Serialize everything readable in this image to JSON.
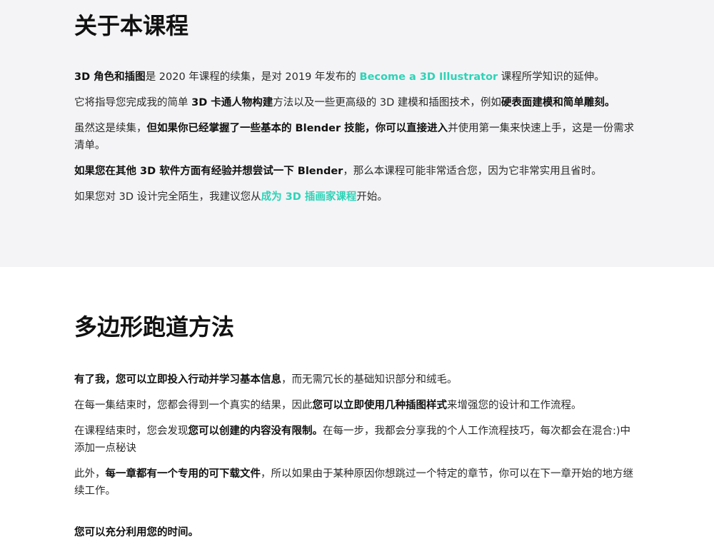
{
  "about": {
    "title": "关于本课程",
    "p1": {
      "bold_intro": "3D 角色和插图",
      "text1": "是 2020 年课程的续集，是对 2019 年发布的 ",
      "link": "Become a 3D Illustrator",
      "text2": " 课程所学知识的延伸。"
    },
    "p2": {
      "text1": "它将指导您完成我的简单 ",
      "bold1": "3D 卡通人物构建",
      "text2": "方法以及一些更高级的 3D 建模和插图技术，例如",
      "bold2": "硬表面建模和简单雕刻。"
    },
    "p3": {
      "text1": "虽然这是续集，",
      "bold1": "但如果你已经掌握了一些基本的 Blender 技能，你可以直接进入",
      "text2": "并使用第一集来快速上手，这是一份需求清单。"
    },
    "p4": {
      "bold1": "如果您在其他 3D 软件方面有经验并想尝试一下 Blender",
      "text1": "，那么本课程可能非常适合您，因为它非常实用且省时。"
    },
    "p5": {
      "text1": "如果您对 3D 设计完全陌生，我建议您从",
      "link": "成为 3D 插画家课程",
      "text2": "开始。"
    }
  },
  "method": {
    "title": "多边形跑道方法",
    "p1": {
      "bold1": "有了我，您可以立即投入行动并学习基本信息",
      "text1": "，而无需冗长的基础知识部分和绒毛。"
    },
    "p2": {
      "text1": "在每一集结束时，您都会得到一个真实的结果，因此",
      "bold1": "您可以立即使用几种插图样式",
      "text2": "来增强您的设计和工作流程。"
    },
    "p3": {
      "text1": "在课程结束时，您会发现",
      "bold1": "您可以创建的内容没有限制。",
      "text2": "在每一步，我都会分享我的个人工作流程技巧，每次都会在混合:)中添加一点秘诀"
    },
    "p4": {
      "text1": "此外，",
      "bold1": "每一章都有一个专用的可下载文件",
      "text2": "，所以如果由于某种原因你想跳过一个特定的章节，你可以在下一章开始的地方继续工作。"
    },
    "closing": "您可以充分利用您的时间。"
  },
  "colors": {
    "link": "#2ed3b7",
    "about_background": "#f4f4f6",
    "text": "#2a2a2a"
  }
}
